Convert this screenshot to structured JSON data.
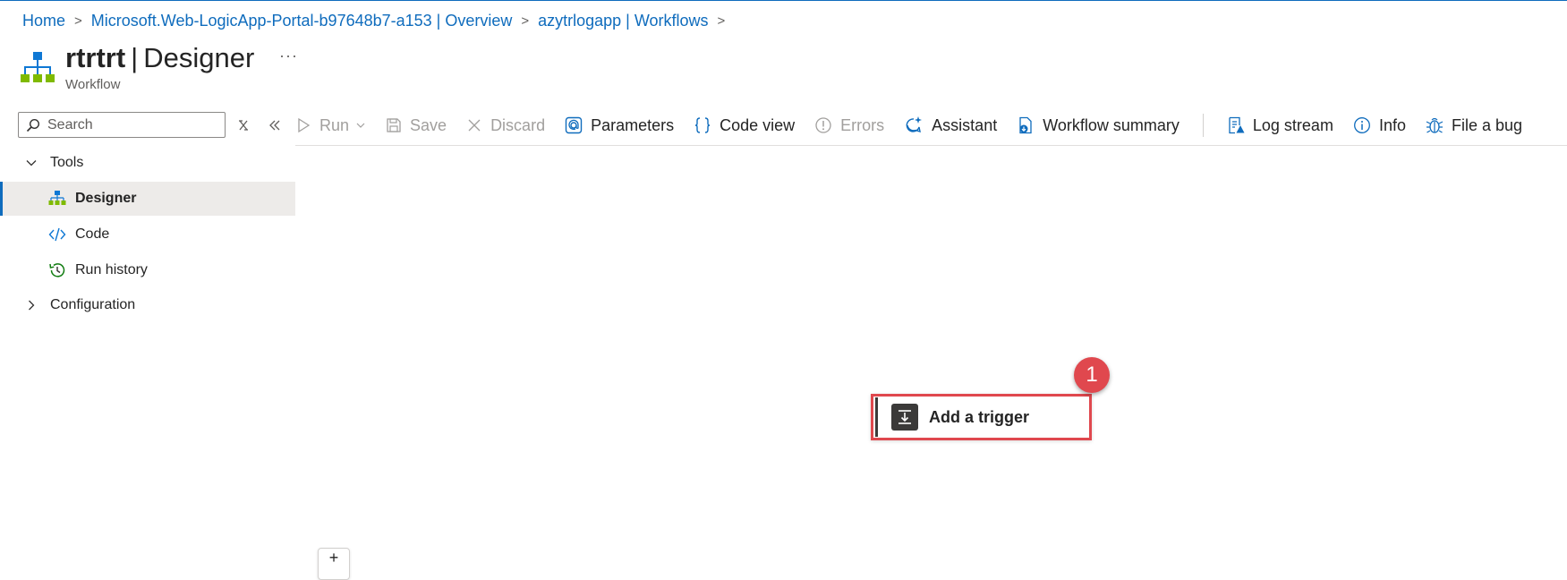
{
  "breadcrumb": {
    "items": [
      {
        "label": "Home"
      },
      {
        "label": "Microsoft.Web-LogicApp-Portal-b97648b7-a153 | Overview"
      },
      {
        "label": "azytrlogapp | Workflows"
      }
    ],
    "separator": ">"
  },
  "header": {
    "title_name": "rtrtrt",
    "title_pipe": "|",
    "title_section": "Designer",
    "subtitle": "Workflow",
    "more_label": "···",
    "icon": "workflow-icon"
  },
  "sidebar": {
    "search": {
      "placeholder": "Search",
      "value": ""
    },
    "groups": [
      {
        "label": "Tools",
        "expanded": true,
        "items": [
          {
            "label": "Designer",
            "icon": "designer-icon",
            "selected": true
          },
          {
            "label": "Code",
            "icon": "code-icon",
            "selected": false
          },
          {
            "label": "Run history",
            "icon": "history-icon",
            "selected": false
          }
        ]
      },
      {
        "label": "Configuration",
        "expanded": false,
        "items": []
      }
    ]
  },
  "toolbar": {
    "run": "Run",
    "save": "Save",
    "discard": "Discard",
    "parameters": "Parameters",
    "code_view": "Code view",
    "errors": "Errors",
    "assistant": "Assistant",
    "workflow_summary": "Workflow summary",
    "log_stream": "Log stream",
    "info": "Info",
    "file_a_bug": "File a bug"
  },
  "canvas": {
    "trigger_label": "Add a trigger",
    "step_badge": "1",
    "zoom_label": "+"
  },
  "colors": {
    "accent": "#0f6cbd",
    "highlight": "#e0484e",
    "selected_bg": "#edebe9"
  }
}
